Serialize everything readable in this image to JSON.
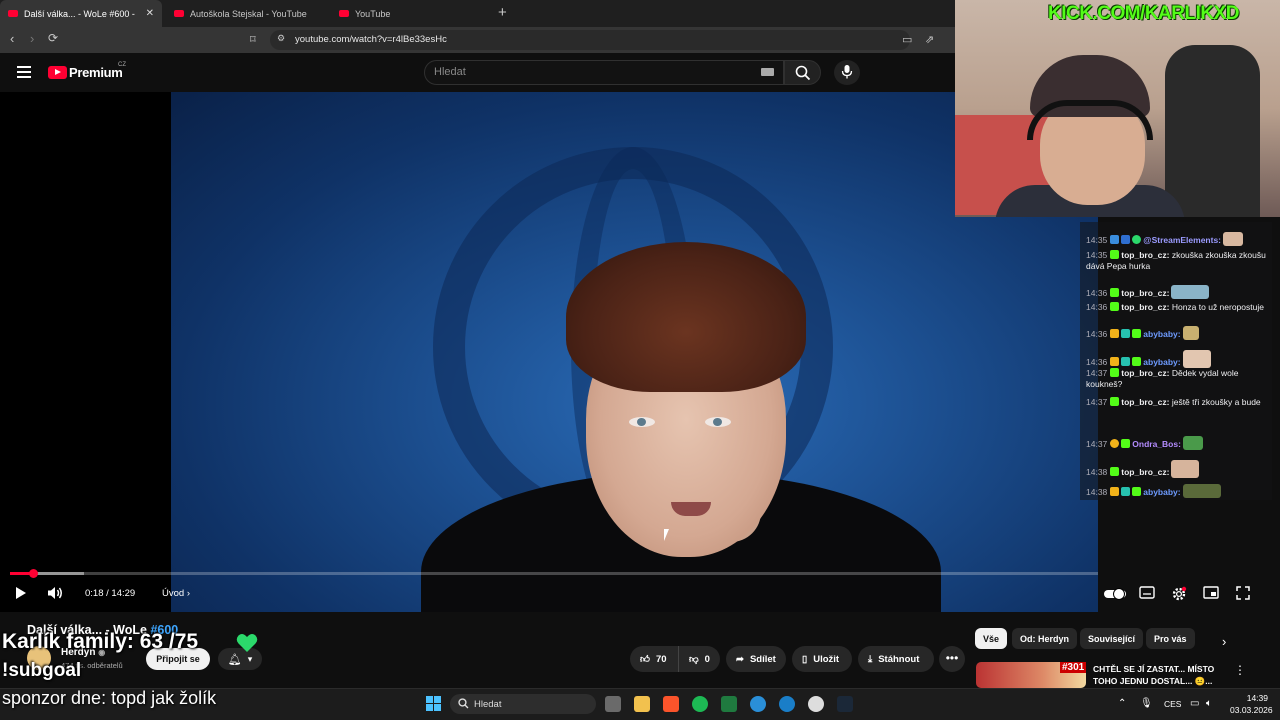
{
  "browser": {
    "tabs": [
      {
        "label": "Další válka... - WoLe #600 - YouT",
        "active": true
      },
      {
        "label": "Autoškola Stejskal - YouTube",
        "active": false
      },
      {
        "label": "YouTube",
        "active": false
      }
    ],
    "new_tab": "+",
    "url": "youtube.com/watch?v=r4lBe33esHc"
  },
  "youtube": {
    "brand": "Premium",
    "region": "CZ",
    "search_placeholder": "Hledat",
    "player": {
      "time": "0:18 / 14:29",
      "chapter": "Úvod",
      "chapter_arrow": "›",
      "progress_fraction": 0.0207,
      "buffer_fraction": 0.068
    },
    "video": {
      "title": "Další válka... - WoLe ",
      "title_tag": "#600",
      "channel": "Herdyn",
      "verified": "◉",
      "subscribers": "474 tis. odběratelů",
      "join_label": "Připojit se",
      "like_count": "70",
      "dislike_count": "0",
      "share_label": "Sdílet",
      "save_label": "Uložit",
      "download_label": "Stáhnout",
      "more": "•••"
    },
    "chips": [
      "Vše",
      "Od: Herdyn",
      "Související",
      "Pro vás"
    ],
    "recommendation": {
      "number": "#301",
      "title": "CHTĚL SE JÍ ZASTAT... MÍSTO TOHO JEDNU DOSTAL... 😐...",
      "menu": "⋮"
    }
  },
  "stream": {
    "kick_url": "KICK.COM/KARLIKXD",
    "family_line": "Karlík family: 63 /75",
    "sub_line": "!subgoal",
    "sponsor_line": "sponzor dne: topd jak žolík",
    "heart_color": "#2bd96b"
  },
  "chat": [
    {
      "time": "14:35",
      "user": "@StreamElements:",
      "text": "",
      "user_color": "#9b9bff"
    },
    {
      "time": "14:35",
      "user": "top_bro_cz:",
      "text": "zkouška zkouška zkoušu dává Pepa hurka",
      "user_color": "#efeff1"
    },
    {
      "time": "14:36",
      "user": "top_bro_cz:",
      "text": "",
      "user_color": "#efeff1"
    },
    {
      "time": "14:36",
      "user": "top_bro_cz:",
      "text": "Honza to už neropostuje",
      "user_color": "#efeff1"
    },
    {
      "time": "14:36",
      "user": "abybaby:",
      "text": "",
      "user_color": "#6e9bff"
    },
    {
      "time": "14:36",
      "user": "abybaby:",
      "text": "",
      "user_color": "#6e9bff"
    },
    {
      "time": "14:37",
      "user": "top_bro_cz:",
      "text": "Dědek vydal wole kouknеš?",
      "user_color": "#efeff1"
    },
    {
      "time": "14:37",
      "user": "top_bro_cz:",
      "text": "ještě tři zkoušky a bude",
      "user_color": "#efeff1"
    },
    {
      "time": "14:37",
      "user": "Ondra_Bos:",
      "text": "",
      "user_color": "#b48cff"
    },
    {
      "time": "14:38",
      "user": "top_bro_cz:",
      "text": "",
      "user_color": "#efeff1"
    },
    {
      "time": "14:38",
      "user": "abybaby:",
      "text": "",
      "user_color": "#6e9bff"
    }
  ],
  "taskbar": {
    "search_label": "Hledat",
    "language": "CES",
    "time": "14:39",
    "date": "03.03.2026"
  },
  "colors": {
    "yt_red": "#ff0033",
    "kick_green": "#53fc18",
    "link_blue": "#3ea6ff"
  }
}
